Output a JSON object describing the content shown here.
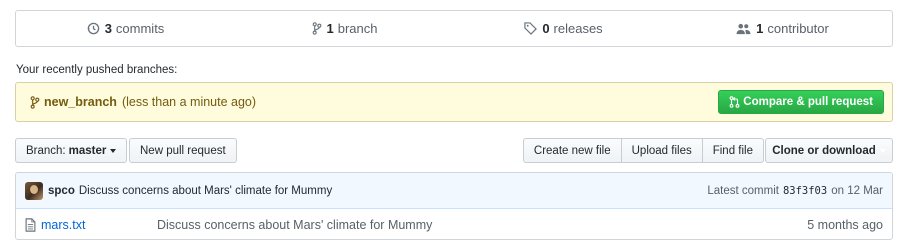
{
  "summary": {
    "commits": {
      "count": "3",
      "label": "commits",
      "icon": "history-icon"
    },
    "branches": {
      "count": "1",
      "label": "branch",
      "icon": "branch-icon"
    },
    "releases": {
      "count": "0",
      "label": "releases",
      "icon": "tag-icon"
    },
    "contributors": {
      "count": "1",
      "label": "contributor",
      "icon": "people-icon"
    }
  },
  "recent": {
    "heading": "Your recently pushed branches:",
    "branch_name": "new_branch",
    "time": "(less than a minute ago)",
    "compare_button": "Compare & pull request"
  },
  "toolbar": {
    "branch_prefix": "Branch:",
    "branch_value": "master",
    "new_pr": "New pull request",
    "create_file": "Create new file",
    "upload_files": "Upload files",
    "find_file": "Find file",
    "clone": "Clone or download"
  },
  "commit": {
    "author": "spco",
    "message": "Discuss concerns about Mars' climate for Mummy",
    "latest_label": "Latest commit",
    "sha": "83f3f03",
    "date": "on 12 Mar"
  },
  "files": [
    {
      "name": "mars.txt",
      "message": "Discuss concerns about Mars' climate for Mummy",
      "age": "5 months ago",
      "icon": "file-icon"
    }
  ],
  "colors": {
    "primary_green": "#28a745",
    "link_blue": "#0366d6",
    "notice_bg": "#fffbdd",
    "commit_bg": "#f1f8ff"
  }
}
